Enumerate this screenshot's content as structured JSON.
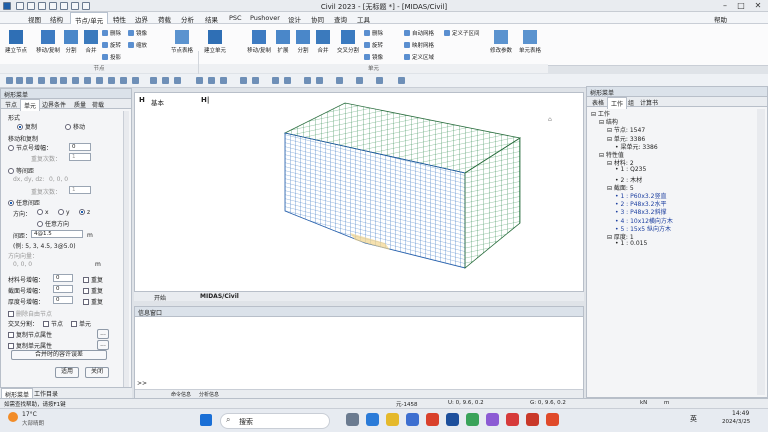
{
  "window": {
    "title": "Civil 2023 - [无标题 *] - [MIDAS/Civil]"
  },
  "menu": [
    "视图",
    "结构",
    "节点/单元",
    "特性",
    "边界",
    "荷载",
    "分析",
    "结果",
    "PSC",
    "Pushover",
    "设计",
    "协同",
    "查询",
    "工具"
  ],
  "menu_right": "帮助",
  "ribbon": {
    "node_group": "节点",
    "elem_group": "单元",
    "b_create_node": "建立节点",
    "b_move_copy": "移动/复制",
    "b_divide": "分割",
    "b_merge": "合并",
    "s_delete": "删除",
    "s_rotate": "旋转",
    "s_project": "投影",
    "s_mirror": "镜像",
    "s_scale": "缩放",
    "b_node_table": "节点表格",
    "b_create_elem": "建立单元",
    "b_move_copy2": "移动/复制",
    "b_extend": "扩展",
    "b_divide2": "分割",
    "b_merge2": "合并",
    "b_cross_divide": "交叉分割",
    "s_delete2": "删除",
    "s_rotate2": "旋转",
    "s_mirror2": "镜像",
    "s_auto_mesh": "自动网格",
    "s_map_mesh": "映射网格",
    "s_define_region": "定义区域",
    "s_user_region": "定义子区间",
    "b_modify_params": "修改参数",
    "b_elem_table": "单元表格"
  },
  "left": {
    "title": "树形菜单",
    "tabs": [
      "节点",
      "单元",
      "边界条件",
      "质量",
      "荷载"
    ],
    "form_label": "形式",
    "opt_copy": "复制",
    "opt_move": "移动",
    "copy_move": "移动和复制",
    "node_num_incr": "节点号增幅：",
    "node_num_val": "0",
    "repeat_times": "重复次数：",
    "repeat_val": "1",
    "equal_spacing": "等间距",
    "dxdydz": "dx, dy, dz:",
    "dxdydz_val": "0, 0, 0",
    "repeat_times2": "重复次数：",
    "repeat_val2": "1",
    "arbitrary": "任意间距",
    "direction": "方向：",
    "dir_x": "x",
    "dir_y": "y",
    "dir_z": "z",
    "arb_dir": "任意方向",
    "spacing": "间距：",
    "spacing_val": "4@1.5",
    "spacing_unit": "m",
    "example": "(例: 5, 3, 4.5, 3@5.0)",
    "dir_vector": "方向向量：",
    "dir_vector_val": "0, 0, 0",
    "dir_unit": "m",
    "mat_incr": "材料号增幅：",
    "sec_incr": "截面号增幅：",
    "thk_incr": "厚度号增幅：",
    "incr_val": "0",
    "repeat": "重复",
    "del_free": "删除自由节点",
    "cross_div": "交叉分割：",
    "node_lbl": "节点",
    "elem_lbl": "单元",
    "copy_node_attr": "复制节点属性",
    "copy_elem_attr": "复制单元属性",
    "merge_tol": "合并时的容许误差",
    "apply": "适用",
    "close": "关闭",
    "bottom_tabs": [
      "树形菜单",
      "工作目录"
    ]
  },
  "viewport": {
    "view_name": "基本",
    "tabs": [
      "开始",
      "MIDAS/Civil"
    ]
  },
  "info": {
    "title": "信息窗口",
    "tabs": [
      "命令信息",
      "分析信息"
    ],
    "prompt": ">>"
  },
  "right": {
    "title": "树形菜单",
    "tabs": [
      "表格",
      "工作",
      "组",
      "计算书"
    ],
    "tree": [
      {
        "t": "工作",
        "l": 0
      },
      {
        "t": "结构",
        "l": 1
      },
      {
        "t": "节点: 1547",
        "l": 2
      },
      {
        "t": "单元: 3386",
        "l": 2
      },
      {
        "t": "梁单元: 3386",
        "l": 3
      },
      {
        "t": "特性值",
        "l": 1
      },
      {
        "t": "材料: 2",
        "l": 2
      },
      {
        "t": "1 : Q235",
        "l": 3
      },
      {
        "t": "2 : 木材",
        "l": 3
      },
      {
        "t": "截面: 5",
        "l": 2
      },
      {
        "t": "1 : P60x3.2竖直",
        "l": 3
      },
      {
        "t": "2 : P48x3.2水平",
        "l": 3
      },
      {
        "t": "3 : P48x3.2斜撑",
        "l": 3
      },
      {
        "t": "4 : 10x12横向方木",
        "l": 3
      },
      {
        "t": "5 : 15x5 纵向方木",
        "l": 3
      },
      {
        "t": "厚度: 1",
        "l": 2
      },
      {
        "t": "1 : 0.015",
        "l": 3
      }
    ]
  },
  "status": {
    "hint": "如需查找帮助，请按F1键",
    "elem": "元-1458",
    "coords": "U: 0, 9.6, 0.2",
    "global": "G: 0, 9.6, 0.2",
    "unit1": "kN",
    "unit2": "m"
  },
  "taskbar": {
    "temp": "17°C",
    "weather": "大部晴朗",
    "search": "搜索",
    "lang": "英",
    "time": "14:49",
    "date": "2024/3/25"
  }
}
